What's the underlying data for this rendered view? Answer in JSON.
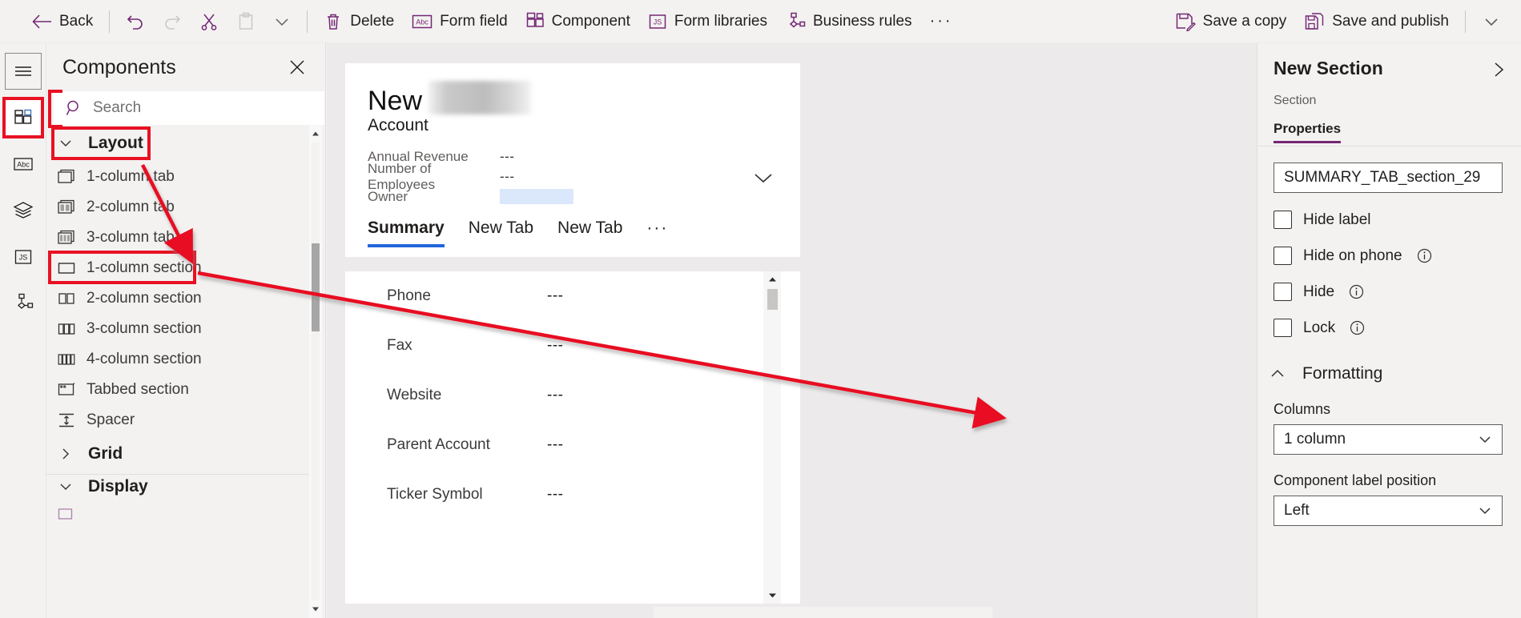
{
  "toolbar": {
    "back": "Back",
    "undo_icon": "undo-icon",
    "redo_icon": "redo-icon",
    "cut_icon": "cut-icon",
    "paste_icon": "paste-icon",
    "paste_chevron_icon": "chevron-down-icon",
    "delete": "Delete",
    "form_field": "Form field",
    "component": "Component",
    "form_libraries": "Form libraries",
    "business_rules": "Business rules",
    "overflow": "···",
    "save_a_copy": "Save a copy",
    "save_and_publish": "Save and publish",
    "more_chevron": "chevron-down-icon"
  },
  "rail": {
    "items": [
      {
        "name": "hamburger-menu",
        "icon": "hamburger-icon",
        "selected": false
      },
      {
        "name": "components",
        "icon": "components-grid-icon",
        "selected": true
      },
      {
        "name": "fields",
        "icon": "abc-icon",
        "selected": false
      },
      {
        "name": "layers",
        "icon": "layers-icon",
        "selected": false
      },
      {
        "name": "form-libraries",
        "icon": "js-icon",
        "selected": false
      },
      {
        "name": "business-rules",
        "icon": "business-rules-icon",
        "selected": false
      }
    ]
  },
  "components_panel": {
    "title": "Components",
    "close_icon": "close-icon",
    "search": {
      "placeholder": "Search",
      "value": "",
      "icon": "search-icon"
    },
    "groups": [
      {
        "label": "Layout",
        "expanded": true,
        "highlighted": true,
        "items": [
          {
            "label": "1-column tab",
            "icon": "one-column-tab-icon",
            "highlighted": false
          },
          {
            "label": "2-column tab",
            "icon": "two-column-tab-icon",
            "highlighted": false
          },
          {
            "label": "3-column tab",
            "icon": "three-column-tab-icon",
            "highlighted": false
          },
          {
            "label": "1-column section",
            "icon": "one-column-section-icon",
            "highlighted": true
          },
          {
            "label": "2-column section",
            "icon": "two-column-section-icon",
            "highlighted": false
          },
          {
            "label": "3-column section",
            "icon": "three-column-section-icon",
            "highlighted": false
          },
          {
            "label": "4-column section",
            "icon": "four-column-section-icon",
            "highlighted": false
          },
          {
            "label": "Tabbed section",
            "icon": "tabbed-section-icon",
            "highlighted": false
          },
          {
            "label": "Spacer",
            "icon": "spacer-icon",
            "highlighted": false
          }
        ]
      },
      {
        "label": "Grid",
        "expanded": false,
        "highlighted": false,
        "items": []
      },
      {
        "label": "Display",
        "expanded": true,
        "highlighted": false,
        "items": []
      }
    ]
  },
  "canvas": {
    "form_title": "New",
    "form_title_redacted": "redacted-entity-name",
    "form_subtitle": "Account",
    "header_fields": [
      {
        "label": "Annual Revenue",
        "value": "---"
      },
      {
        "label": "Number of Employees",
        "value": "---"
      },
      {
        "label": "Owner",
        "value": ""
      }
    ],
    "expand_icon": "chevron-down-icon",
    "tabs": [
      {
        "label": "Summary",
        "active": true
      },
      {
        "label": "New Tab",
        "active": false
      },
      {
        "label": "New Tab",
        "active": false
      }
    ],
    "tabs_overflow": "···",
    "body_fields": [
      {
        "label": "Phone",
        "value": "---"
      },
      {
        "label": "Fax",
        "value": "---"
      },
      {
        "label": "Website",
        "value": "---"
      },
      {
        "label": "Parent Account",
        "value": "---"
      },
      {
        "label": "Ticker Symbol",
        "value": "---"
      }
    ]
  },
  "properties_panel": {
    "title": "New Section",
    "subtitle": "Section",
    "collapse_icon": "chevron-right-icon",
    "tabs": [
      {
        "label": "Properties",
        "active": true
      }
    ],
    "name_field": {
      "value": "SUMMARY_TAB_section_29"
    },
    "checkboxes": [
      {
        "label": "Hide label",
        "checked": false,
        "info": false
      },
      {
        "label": "Hide on phone",
        "checked": false,
        "info": true
      },
      {
        "label": "Hide",
        "checked": false,
        "info": true
      },
      {
        "label": "Lock",
        "checked": false,
        "info": true
      }
    ],
    "formatting": {
      "label": "Formatting",
      "expanded": true,
      "columns_label": "Columns",
      "columns_value": "1 column",
      "label_position_label": "Component label position",
      "label_position_value": "Left"
    }
  },
  "colors": {
    "accent_purple": "#742774",
    "annotation_red": "#e81123",
    "tab_underline_blue": "#2266dd",
    "panel_bg": "#f3f2f1",
    "canvas_bg": "#eceaea"
  }
}
